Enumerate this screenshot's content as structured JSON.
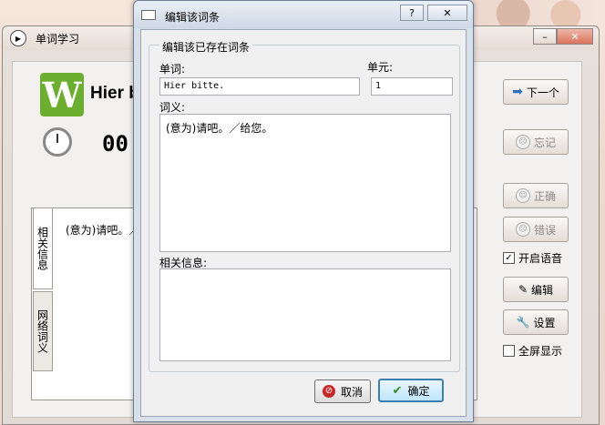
{
  "main_window": {
    "title": "单词学习",
    "word": "Hier bitte.",
    "timer": "00",
    "definition": "(意为)请吧。／",
    "tabs": {
      "related": "相关信息",
      "web_meaning": "网络词义"
    },
    "buttons": {
      "next": "下一个",
      "forget": "忘记",
      "correct": "正确",
      "wrong": "错误",
      "edit": "编辑",
      "settings": "设置"
    },
    "checkboxes": {
      "voice": {
        "label": "开启语音",
        "checked": true
      },
      "fullscreen": {
        "label": "全屏显示",
        "checked": false
      }
    }
  },
  "dialog": {
    "title": "编辑该词条",
    "group_label": "编辑该已存在词条",
    "word_label": "单词:",
    "word_value": "Hier bitte.",
    "unit_label": "单元:",
    "unit_value": "1",
    "meaning_label": "词义:",
    "meaning_value": "(意为)请吧。／给您。",
    "related_label": "相关信息:",
    "related_value": "",
    "cancel_label": "取消",
    "ok_label": "确定",
    "help_glyph": "?",
    "close_glyph": "✕"
  }
}
